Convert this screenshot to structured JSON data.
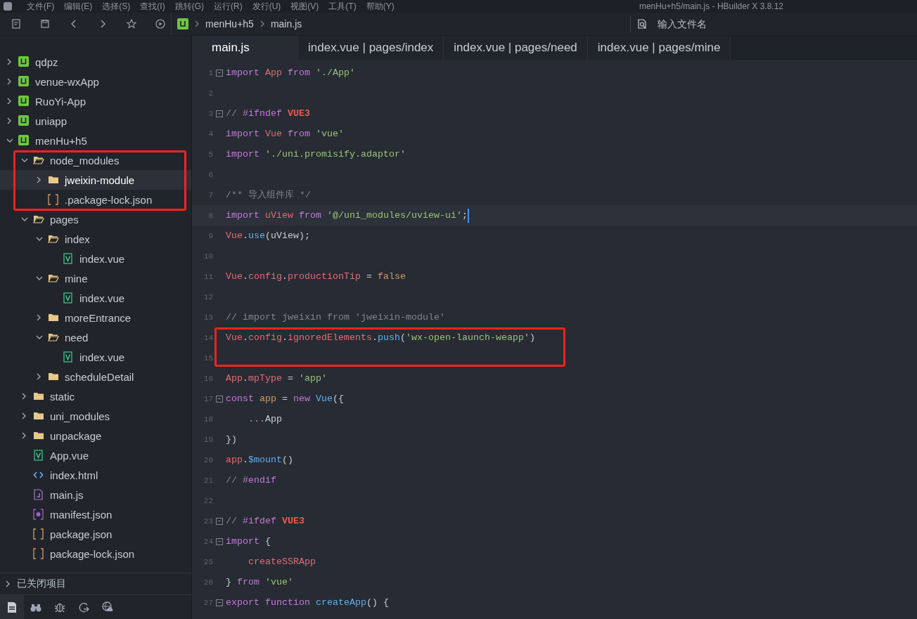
{
  "window": {
    "title": "menHu+h5/main.js - HBuilder X 3.8.12"
  },
  "menu": [
    "文件(F)",
    "编辑(E)",
    "选择(S)",
    "查找(I)",
    "跳转(G)",
    "运行(R)",
    "发行(U)",
    "视图(V)",
    "工具(T)",
    "帮助(Y)"
  ],
  "toolbar": {
    "breadcrumb": [
      "menHu+h5",
      "main.js"
    ],
    "search": {
      "placeholder": "输入文件名"
    }
  },
  "tree": [
    {
      "name": "qdpz",
      "kind": "project",
      "expanded": false,
      "selected": false
    },
    {
      "name": "venue-wxApp",
      "kind": "project",
      "expanded": false,
      "selected": false
    },
    {
      "name": "RuoYi-App",
      "kind": "project",
      "expanded": false,
      "selected": false
    },
    {
      "name": "uniapp",
      "kind": "project",
      "expanded": false,
      "selected": false
    },
    {
      "name": "menHu+h5",
      "kind": "project",
      "expanded": true,
      "selected": false,
      "children": [
        {
          "name": "node_modules",
          "kind": "folder",
          "expanded": true,
          "selected": false,
          "children": [
            {
              "name": "jweixin-module",
              "kind": "folder",
              "expanded": false,
              "selected": true
            },
            {
              "name": ".package-lock.json",
              "kind": "json",
              "selected": false
            }
          ]
        },
        {
          "name": "pages",
          "kind": "folder",
          "expanded": true,
          "selected": false,
          "children": [
            {
              "name": "index",
              "kind": "folder",
              "expanded": true,
              "selected": false,
              "children": [
                {
                  "name": "index.vue",
                  "kind": "vue",
                  "selected": false
                }
              ]
            },
            {
              "name": "mine",
              "kind": "folder",
              "expanded": true,
              "selected": false,
              "children": [
                {
                  "name": "index.vue",
                  "kind": "vue",
                  "selected": false
                }
              ]
            },
            {
              "name": "moreEntrance",
              "kind": "folder",
              "expanded": false,
              "selected": false
            },
            {
              "name": "need",
              "kind": "folder",
              "expanded": true,
              "selected": false,
              "children": [
                {
                  "name": "index.vue",
                  "kind": "vue",
                  "selected": false
                }
              ]
            },
            {
              "name": "scheduleDetail",
              "kind": "folder",
              "expanded": false,
              "selected": false
            }
          ]
        },
        {
          "name": "static",
          "kind": "folder",
          "expanded": false,
          "selected": false
        },
        {
          "name": "uni_modules",
          "kind": "folder",
          "expanded": false,
          "selected": false
        },
        {
          "name": "unpackage",
          "kind": "folder",
          "expanded": false,
          "selected": false
        },
        {
          "name": "App.vue",
          "kind": "vue",
          "selected": false
        },
        {
          "name": "index.html",
          "kind": "html",
          "selected": false
        },
        {
          "name": "main.js",
          "kind": "js",
          "selected": false
        },
        {
          "name": "manifest.json",
          "kind": "manifest",
          "selected": false
        },
        {
          "name": "package.json",
          "kind": "json",
          "selected": false
        },
        {
          "name": "package-lock.json",
          "kind": "json",
          "selected": false
        }
      ]
    }
  ],
  "closed_projects": {
    "label": "已关闭项目",
    "expanded": false
  },
  "tabs": [
    {
      "label": "main.js",
      "selected": true
    },
    {
      "label": "index.vue | pages/index",
      "selected": false
    },
    {
      "label": "index.vue | pages/need",
      "selected": false
    },
    {
      "label": "index.vue | pages/mine",
      "selected": false
    }
  ],
  "code": [
    {
      "n": "1",
      "fold": true,
      "current": false,
      "tokens": [
        {
          "kind": "kw",
          "text": "import "
        },
        {
          "kind": "var",
          "text": "App "
        },
        {
          "kind": "kw",
          "text": "from "
        },
        {
          "kind": "str",
          "text": "'./App'"
        }
      ]
    },
    {
      "n": "2",
      "fold": false,
      "current": false
    },
    {
      "n": "3",
      "fold": true,
      "current": false,
      "tokens": [
        {
          "kind": "com",
          "text": "// "
        },
        {
          "kind": "dir",
          "text": "#ifndef "
        },
        {
          "kind": "mac",
          "text": "VUE3"
        }
      ]
    },
    {
      "n": "4",
      "fold": false,
      "current": false,
      "tokens": [
        {
          "kind": "kw",
          "text": "import "
        },
        {
          "kind": "var",
          "text": "Vue "
        },
        {
          "kind": "kw",
          "text": "from "
        },
        {
          "kind": "str",
          "text": "'vue'"
        }
      ]
    },
    {
      "n": "5",
      "fold": false,
      "current": false,
      "tokens": [
        {
          "kind": "kw",
          "text": "import "
        },
        {
          "kind": "str",
          "text": "'./uni.promisify.adaptor'"
        }
      ]
    },
    {
      "n": "6",
      "fold": false,
      "current": false
    },
    {
      "n": "7",
      "fold": false,
      "current": false,
      "tokens": [
        {
          "kind": "com",
          "text": "/** 导入组件库 */"
        }
      ]
    },
    {
      "n": "8",
      "fold": false,
      "current": true,
      "tokens": [
        {
          "kind": "kw",
          "text": "import "
        },
        {
          "kind": "var",
          "text": "uView "
        },
        {
          "kind": "kw",
          "text": "from "
        },
        {
          "kind": "str",
          "text": "'@/uni_modules/uview-ui'"
        },
        {
          "kind": "pl",
          "text": ";"
        }
      ]
    },
    {
      "n": "9",
      "fold": false,
      "current": false,
      "tokens": [
        {
          "kind": "var",
          "text": "Vue"
        },
        {
          "kind": "pl",
          "text": "."
        },
        {
          "kind": "fn",
          "text": "use"
        },
        {
          "kind": "pl",
          "text": "(uView);"
        }
      ]
    },
    {
      "n": "10",
      "fold": false,
      "current": false
    },
    {
      "n": "11",
      "fold": false,
      "current": false,
      "tokens": [
        {
          "kind": "var",
          "text": "Vue"
        },
        {
          "kind": "pl",
          "text": "."
        },
        {
          "kind": "var",
          "text": "config"
        },
        {
          "kind": "pl",
          "text": "."
        },
        {
          "kind": "var",
          "text": "productionTip "
        },
        {
          "kind": "pl",
          "text": "= "
        },
        {
          "kind": "lit",
          "text": "false"
        }
      ]
    },
    {
      "n": "12",
      "fold": false,
      "current": false
    },
    {
      "n": "13",
      "fold": false,
      "current": false,
      "tokens": [
        {
          "kind": "com",
          "text": "// import jweixin from 'jweixin-module'"
        }
      ]
    },
    {
      "n": "14",
      "fold": false,
      "current": false,
      "tokens": [
        {
          "kind": "var",
          "text": "Vue"
        },
        {
          "kind": "pl",
          "text": "."
        },
        {
          "kind": "var",
          "text": "config"
        },
        {
          "kind": "pl",
          "text": "."
        },
        {
          "kind": "var",
          "text": "ignoredElements"
        },
        {
          "kind": "pl",
          "text": "."
        },
        {
          "kind": "fn",
          "text": "push"
        },
        {
          "kind": "pl",
          "text": "("
        },
        {
          "kind": "str",
          "text": "'wx-open-launch-weapp'"
        },
        {
          "kind": "pl",
          "text": ")"
        }
      ]
    },
    {
      "n": "15",
      "fold": false,
      "current": false
    },
    {
      "n": "16",
      "fold": false,
      "current": false,
      "tokens": [
        {
          "kind": "var",
          "text": "App"
        },
        {
          "kind": "pl",
          "text": "."
        },
        {
          "kind": "var",
          "text": "mpType "
        },
        {
          "kind": "pl",
          "text": "= "
        },
        {
          "kind": "str",
          "text": "'app'"
        }
      ]
    },
    {
      "n": "17",
      "fold": true,
      "current": false,
      "tokens": [
        {
          "kind": "kw",
          "text": "const "
        },
        {
          "kind": "lit",
          "text": "app "
        },
        {
          "kind": "pl",
          "text": "= "
        },
        {
          "kind": "kw",
          "text": "new "
        },
        {
          "kind": "fn",
          "text": "Vue"
        },
        {
          "kind": "pl",
          "text": "({"
        }
      ]
    },
    {
      "n": "18",
      "fold": false,
      "current": false,
      "tokens": [
        {
          "kind": "kw",
          "text": "    ..."
        },
        {
          "kind": "pl",
          "text": "App"
        }
      ]
    },
    {
      "n": "19",
      "fold": false,
      "current": false,
      "tokens": [
        {
          "kind": "pl",
          "text": "})"
        }
      ]
    },
    {
      "n": "20",
      "fold": false,
      "current": false,
      "tokens": [
        {
          "kind": "var",
          "text": "app"
        },
        {
          "kind": "pl",
          "text": "."
        },
        {
          "kind": "fn",
          "text": "$mount"
        },
        {
          "kind": "pl",
          "text": "()"
        }
      ]
    },
    {
      "n": "21",
      "fold": false,
      "current": false,
      "tokens": [
        {
          "kind": "com",
          "text": "// "
        },
        {
          "kind": "dir",
          "text": "#endif"
        }
      ]
    },
    {
      "n": "22",
      "fold": false,
      "current": false
    },
    {
      "n": "23",
      "fold": true,
      "current": false,
      "tokens": [
        {
          "kind": "com",
          "text": "// "
        },
        {
          "kind": "dir",
          "text": "#ifdef "
        },
        {
          "kind": "mac",
          "text": "VUE3"
        }
      ]
    },
    {
      "n": "24",
      "fold": true,
      "current": false,
      "tokens": [
        {
          "kind": "kw",
          "text": "import "
        },
        {
          "kind": "pl",
          "text": "{"
        }
      ]
    },
    {
      "n": "25",
      "fold": false,
      "current": false,
      "tokens": [
        {
          "kind": "var",
          "text": "    createSSRApp"
        }
      ]
    },
    {
      "n": "26",
      "fold": false,
      "current": false,
      "tokens": [
        {
          "kind": "pl",
          "text": "} "
        },
        {
          "kind": "kw",
          "text": "from "
        },
        {
          "kind": "str",
          "text": "'vue'"
        }
      ]
    },
    {
      "n": "27",
      "fold": true,
      "current": false,
      "tokens": [
        {
          "kind": "kw",
          "text": "export "
        },
        {
          "kind": "kw",
          "text": "function "
        },
        {
          "kind": "fn",
          "text": "createApp"
        },
        {
          "kind": "pl",
          "text": "() {"
        }
      ]
    }
  ]
}
